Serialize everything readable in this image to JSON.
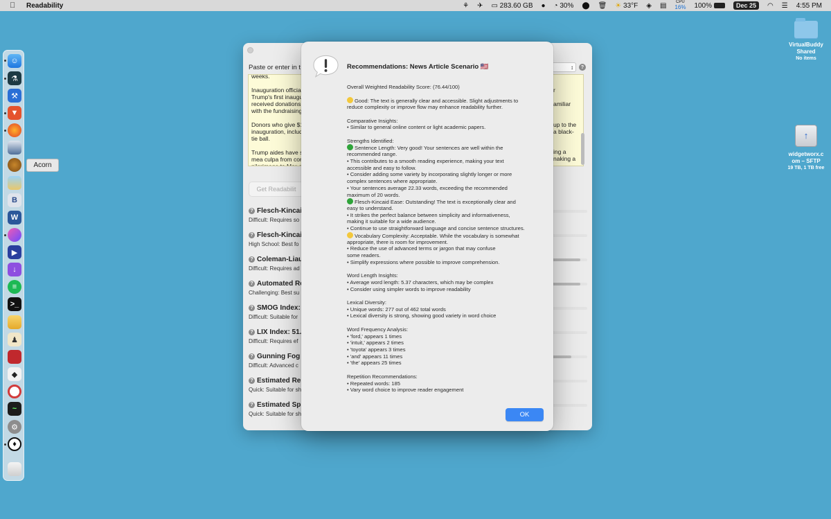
{
  "menubar": {
    "app_name": "Readability",
    "storage": "283.60 GB",
    "progress": "30%",
    "weather": "33°F",
    "cpu_label": "CPU",
    "cpu_value": "16%",
    "battery": "100%",
    "date": "Dec 25",
    "time": "4:55 PM"
  },
  "dock": {
    "tooltip": "Acorn",
    "icons": [
      "finder-icon",
      "instruments-icon",
      "xcode-tools-icon",
      "brave-icon",
      "firefox-icon",
      "scanner-icon",
      "acorn-icon",
      "preview-icon",
      "bbedit-icon",
      "word-icon",
      "arc-icon",
      "infuse-icon",
      "downloader-icon",
      "spotify-icon",
      "terminal-icon",
      "drive-icon",
      "marathon-icon",
      "screen-icon",
      "layers-icon",
      "record-icon",
      "activity-icon",
      "settings-icon",
      "widget-icon",
      "trash-icon"
    ]
  },
  "desktop": {
    "folder_name_1": "VirtualBuddy",
    "folder_name_2": "Shared",
    "folder_sub": "No items",
    "drive_name_1": "widgetworx.c",
    "drive_name_2": "om – SFTP",
    "drive_sub": "19 TB, 1 TB free"
  },
  "background_window": {
    "prompt": "Paste or enter in t",
    "text_paragraphs": [
      "weeks.",
      "Inauguration official\nTrump's first inaugu\nreceived donations\nwith the fundraising",
      "Donors who give $1\ninauguration, includ\ntie ball.",
      "Trump aides have s\nmea culpa from cor\npilgrimage to Mar-a"
    ],
    "text_right": [
      "r",
      "amiliar",
      "up to the\na black-",
      "ing a\nnaking a"
    ],
    "button_label": "Get Readabilit",
    "metrics": [
      {
        "title": "Flesch-Kincai",
        "desc": "Difficult: Requires so",
        "fill": 0
      },
      {
        "title": "Flesch-Kincai",
        "desc": "High School: Best fo",
        "fill": 0
      },
      {
        "title": "Coleman-Liau",
        "desc": "Difficult: Requires ad",
        "fill": 0.8
      },
      {
        "title": "Automated Re",
        "desc": "Challenging: Best su",
        "fill": 0.8
      },
      {
        "title": "SMOG Index:",
        "desc": "Difficult: Suitable for",
        "fill": 0
      },
      {
        "title": "LIX Index: 51.",
        "desc": "Difficult: Requires ef",
        "fill": 0
      },
      {
        "title": "Gunning Fog I",
        "desc": "Difficult: Advanced c",
        "fill": 0.55
      },
      {
        "title": "Estimated Re",
        "desc": "Quick: Suitable for sh",
        "fill": 0
      },
      {
        "title": "Estimated Sp",
        "desc": "Quick: Suitable for sh",
        "fill": 0
      }
    ]
  },
  "dialog": {
    "title": "Recommendations: News Article Scenario 🇺🇸",
    "lines": [
      {
        "t": "Overall Weighted Readability Score: (76.44/100)"
      },
      {
        "gap": true
      },
      {
        "t": "Good: The text is generally clear and accessible. Slight adjustments to",
        "dot": "y"
      },
      {
        "t": "reduce complexity or improve flow may enhance readability further."
      },
      {
        "gap": true
      },
      {
        "t": "Comparative Insights:"
      },
      {
        "t": "• Similar to general online content or light academic papers."
      },
      {
        "gap": true
      },
      {
        "t": "Strengths Identified:"
      },
      {
        "t": "Sentence Length: Very good! Your sentences are well within the",
        "dot": "g"
      },
      {
        "t": "recommended range."
      },
      {
        "t": "• This contributes to a smooth reading experience, making your text"
      },
      {
        "t": "accessible and easy to follow."
      },
      {
        "t": "• Consider adding some variety by incorporating slightly longer or more"
      },
      {
        "t": "complex sentences where appropriate."
      },
      {
        "t": "• Your sentences average 22.33 words, exceeding the recommended"
      },
      {
        "t": "maximum of 20 words."
      },
      {
        "t": "Flesch-Kincaid Ease: Outstanding! The text is exceptionally clear and",
        "dot": "g"
      },
      {
        "t": "easy to understand."
      },
      {
        "t": "• It strikes the perfect balance between simplicity and informativeness,"
      },
      {
        "t": "making it suitable for a wide audience."
      },
      {
        "t": "• Continue to use straightforward language and concise sentence structures."
      },
      {
        "t": "Vocabulary Complexity: Acceptable. While the vocabulary is somewhat",
        "dot": "y"
      },
      {
        "t": "appropriate, there is room for improvement."
      },
      {
        "t": "• Reduce the use of advanced terms or jargon that may confuse"
      },
      {
        "t": "some readers."
      },
      {
        "t": "• Simplify expressions where possible to improve comprehension."
      },
      {
        "gap": true
      },
      {
        "t": "Word Length Insights:"
      },
      {
        "t": "• Average word length: 5.37 characters, which may be complex"
      },
      {
        "t": "• Consider using simpler words to improve readability"
      },
      {
        "gap": true
      },
      {
        "t": "Lexical Diversity:"
      },
      {
        "t": "• Unique words: 277 out of 462 total words"
      },
      {
        "t": "• Lexical diversity is strong, showing good variety in word choice"
      },
      {
        "gap": true
      },
      {
        "t": "Word Frequency Analysis:"
      },
      {
        "t": "• 'ford,' appears 1 times"
      },
      {
        "t": "• 'intuit,' appears 2 times"
      },
      {
        "t": "• 'toyota' appears 3 times"
      },
      {
        "t": "• 'and' appears 11 times"
      },
      {
        "t": "• 'the' appears 25 times"
      },
      {
        "gap": true
      },
      {
        "t": "Repetition Recommendations:"
      },
      {
        "t": "• Repeated words: 185"
      },
      {
        "t": "• Vary word choice to improve reader engagement"
      }
    ],
    "ok_label": "OK"
  },
  "colors": {
    "desktop": "#4fa7cd",
    "accent": "#3b87f4",
    "good_dot": "#f3c83c",
    "strong_dot": "#2fa43a"
  }
}
